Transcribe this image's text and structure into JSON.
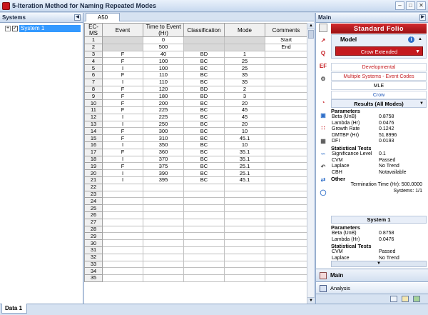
{
  "window": {
    "title": "5-Iteration Method for Naming Repeated Modes",
    "controls": [
      "–",
      "□",
      "✕"
    ]
  },
  "left_panel": {
    "title": "Systems",
    "items": [
      {
        "label": "System 1",
        "checked": true
      }
    ]
  },
  "bottom": {
    "sheet_tab": "Data 1"
  },
  "sheet": {
    "tab": "A50",
    "columns": [
      "EC-MS",
      "Event",
      "Time to Event (Hr)",
      "Classification",
      "Mode",
      "Comments"
    ],
    "fixed_rows": [
      {
        "num": "1",
        "time": "0",
        "comment": "Start"
      },
      {
        "num": "2",
        "time": "500",
        "comment": "End"
      }
    ],
    "rows": [
      {
        "num": "3",
        "event": "F",
        "time": "40",
        "cls": "BD",
        "mode": "1"
      },
      {
        "num": "4",
        "event": "F",
        "time": "100",
        "cls": "BC",
        "mode": "25"
      },
      {
        "num": "5",
        "event": "I",
        "time": "100",
        "cls": "BC",
        "mode": "25"
      },
      {
        "num": "6",
        "event": "F",
        "time": "110",
        "cls": "BC",
        "mode": "35"
      },
      {
        "num": "7",
        "event": "I",
        "time": "110",
        "cls": "BC",
        "mode": "35"
      },
      {
        "num": "8",
        "event": "F",
        "time": "120",
        "cls": "BD",
        "mode": "2"
      },
      {
        "num": "9",
        "event": "F",
        "time": "180",
        "cls": "BD",
        "mode": "3"
      },
      {
        "num": "10",
        "event": "F",
        "time": "200",
        "cls": "BC",
        "mode": "20"
      },
      {
        "num": "11",
        "event": "F",
        "time": "225",
        "cls": "BC",
        "mode": "45"
      },
      {
        "num": "12",
        "event": "I",
        "time": "225",
        "cls": "BC",
        "mode": "45"
      },
      {
        "num": "13",
        "event": "I",
        "time": "250",
        "cls": "BC",
        "mode": "20"
      },
      {
        "num": "14",
        "event": "F",
        "time": "300",
        "cls": "BC",
        "mode": "10"
      },
      {
        "num": "15",
        "event": "F",
        "time": "310",
        "cls": "BC",
        "mode": "45.1"
      },
      {
        "num": "16",
        "event": "I",
        "time": "350",
        "cls": "BC",
        "mode": "10"
      },
      {
        "num": "17",
        "event": "F",
        "time": "360",
        "cls": "BC",
        "mode": "35.1"
      },
      {
        "num": "18",
        "event": "I",
        "time": "370",
        "cls": "BC",
        "mode": "35.1"
      },
      {
        "num": "19",
        "event": "F",
        "time": "375",
        "cls": "BC",
        "mode": "25.1"
      },
      {
        "num": "20",
        "event": "I",
        "time": "390",
        "cls": "BC",
        "mode": "25.1"
      },
      {
        "num": "21",
        "event": "I",
        "time": "395",
        "cls": "BC",
        "mode": "45.1"
      }
    ],
    "empty_rows": [
      "22",
      "23",
      "24",
      "25",
      "26",
      "27",
      "28",
      "29",
      "30",
      "31",
      "32",
      "33",
      "34",
      "35"
    ]
  },
  "right_panel": {
    "title": "Main",
    "folio_label": "Standard Folio",
    "model_label": "Model",
    "model_value": "Crow Extended",
    "options": [
      "Developmental",
      "Multiple Systems - Event Codes",
      "MLE",
      "Crow"
    ],
    "results_title": "Results (All Modes)",
    "parameters_label": "Parameters",
    "parameters": [
      {
        "k": "Beta (UnB)",
        "v": "0.8758"
      },
      {
        "k": "Lambda (Hr)",
        "v": "0.0476"
      },
      {
        "k": "Growth Rate",
        "v": "0.1242"
      },
      {
        "k": "DMTBF (Hr)",
        "v": "51.8996"
      },
      {
        "k": "DFI",
        "v": "0.0193"
      }
    ],
    "tests_label": "Statistical Tests",
    "tests": [
      {
        "k": "Significance Level",
        "v": "0.1"
      },
      {
        "k": "CVM",
        "v": "Passed"
      },
      {
        "k": "Laplace",
        "v": "No Trend"
      },
      {
        "k": "CBH",
        "v": "Notavailable"
      }
    ],
    "other_label": "Other",
    "termination": "Termination Time (Hr): 500.0000",
    "systems": "Systems: 1/1",
    "system_title": "System 1",
    "sys_parameters_label": "Parameters",
    "sys_parameters": [
      {
        "k": "Beta (UnB)",
        "v": "0.8758"
      },
      {
        "k": "Lambda (Hr)",
        "v": "0.0476"
      }
    ],
    "sys_tests_label": "Statistical Tests",
    "sys_tests": [
      {
        "k": "CVM",
        "v": "Passed"
      },
      {
        "k": "Laplace",
        "v": "No Trend"
      }
    ],
    "nav_main": "Main",
    "nav_analysis": "Analysis"
  }
}
